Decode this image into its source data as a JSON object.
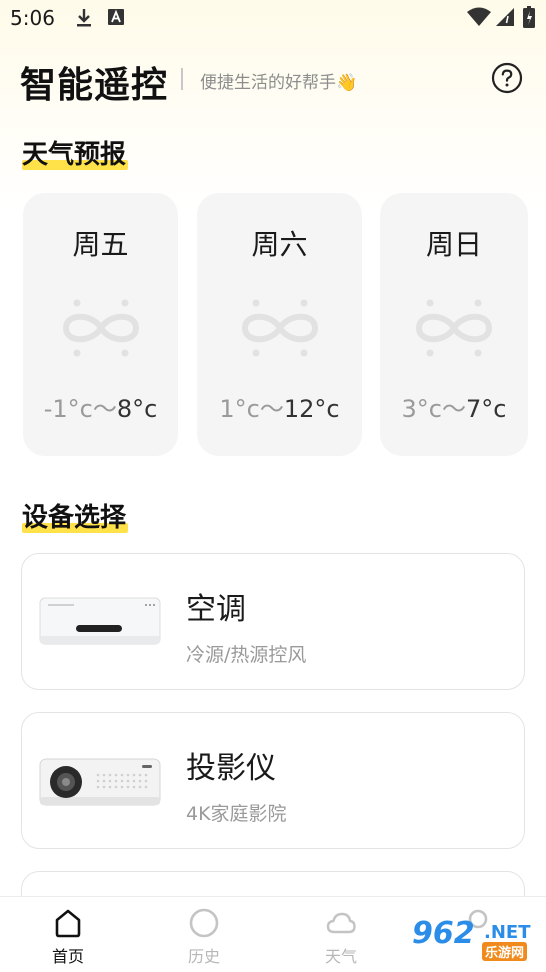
{
  "status_bar": {
    "time": "5:06",
    "icons": [
      "download-icon",
      "text-a-icon",
      "wifi-icon",
      "signal-icon",
      "battery-icon"
    ]
  },
  "header": {
    "title": "智能遥控",
    "subtitle": "便捷生活的好帮手👋",
    "help_icon": "help-icon"
  },
  "weather_section": {
    "title": "天气预报",
    "days": [
      {
        "day": "周五",
        "low": "-1°c",
        "sep": "～",
        "high": "8°c",
        "icon": "infinity-icon"
      },
      {
        "day": "周六",
        "low": "1°c",
        "sep": "～",
        "high": "12°c",
        "icon": "infinity-icon"
      },
      {
        "day": "周日",
        "low": "3°c",
        "sep": "～",
        "high": "7°c",
        "icon": "infinity-icon"
      }
    ]
  },
  "device_section": {
    "title": "设备选择",
    "devices": [
      {
        "name": "空调",
        "desc": "冷源/热源控风",
        "icon": "air-conditioner-icon"
      },
      {
        "name": "投影仪",
        "desc": "4K家庭影院",
        "icon": "projector-icon"
      }
    ]
  },
  "bottom_nav": {
    "items": [
      {
        "label": "首页",
        "icon": "home-icon",
        "active": true
      },
      {
        "label": "历史",
        "icon": "history-icon",
        "active": false
      },
      {
        "label": "天气",
        "icon": "cloud-icon",
        "active": false
      },
      {
        "label": "",
        "icon": "user-icon",
        "active": false
      }
    ]
  },
  "watermark": {
    "big": "962",
    "net": ".NET",
    "small": "乐游网"
  },
  "colors": {
    "accent": "#ffe14a",
    "card_bg": "#f5f5f5",
    "text": "#1a1a1a",
    "muted": "#9a9a9a"
  }
}
